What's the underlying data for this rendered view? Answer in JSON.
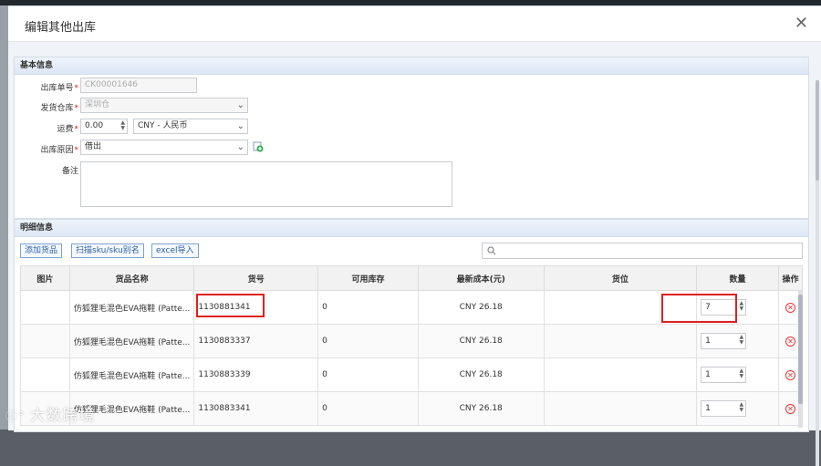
{
  "dialog": {
    "title": "编辑其他出库",
    "close_icon": "close-icon"
  },
  "basic": {
    "section_title": "基本信息",
    "order_no_label": "出库单号",
    "order_no_value": "CK00001646",
    "warehouse_label": "发货仓库",
    "warehouse_value": "深圳仓",
    "freight_label": "运费",
    "freight_value": "0.00",
    "currency_value": "CNY - 人民币",
    "reason_label": "出库原因",
    "reason_value": "借出",
    "remark_label": "备注",
    "remark_value": "",
    "required_mark": "*"
  },
  "detail": {
    "section_title": "明细信息",
    "add_goods_label": "添加货品",
    "scan_sku_label": "扫描sku/sku别名",
    "excel_import_label": "excel导入",
    "search_placeholder": ""
  },
  "table": {
    "columns": [
      "图片",
      "货品名称",
      "货号",
      "可用库存",
      "最新成本(元)",
      "货位",
      "数量",
      "操作"
    ],
    "rows": [
      {
        "name": "仿狐狸毛混色EVA拖鞋 (Patte...",
        "sku": "1130881341",
        "stock": "0",
        "cost": "CNY 26.18",
        "location": "",
        "qty": "7"
      },
      {
        "name": "仿狐狸毛混色EVA拖鞋 (Patte...",
        "sku": "1130883337",
        "stock": "0",
        "cost": "CNY 26.18",
        "location": "",
        "qty": "1"
      },
      {
        "name": "仿狐狸毛混色EVA拖鞋 (Patte...",
        "sku": "1130883339",
        "stock": "0",
        "cost": "CNY 26.18",
        "location": "",
        "qty": "1"
      },
      {
        "name": "仿狐狸毛混色EVA拖鞋 (Patte...",
        "sku": "1130883341",
        "stock": "0",
        "cost": "CNY 26.18",
        "location": "",
        "qty": "1"
      }
    ]
  },
  "watermark": "大数跨境",
  "colors": {
    "accent": "#2b5fa5",
    "highlight": "#e02020",
    "delete": "#e33333"
  }
}
